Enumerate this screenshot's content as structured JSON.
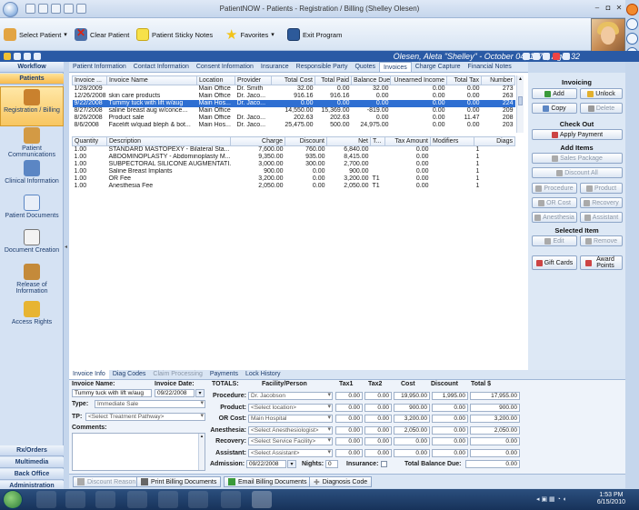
{
  "window": {
    "title": "PatientNOW - Patients - Registration / Billing (Shelley Olesen)",
    "min": "–",
    "max": "◘",
    "close": "✕"
  },
  "toolbar": {
    "select_patient": "Select Patient",
    "clear_patient": "Clear Patient",
    "sticky_notes": "Patient Sticky Notes",
    "favorites": "Favorites",
    "exit_program": "Exit Program"
  },
  "patient_bar": {
    "name": "Olesen, Aleta \"Shelley\" - October 04, 1977, Age: 32"
  },
  "nav": {
    "workflow": "Workflow",
    "patients": "Patients",
    "items": [
      {
        "label": "Registration / Billing",
        "icon": "person-icon"
      },
      {
        "label": "Patient Communications",
        "icon": "megaphone-icon"
      },
      {
        "label": "Clinical Information",
        "icon": "stethoscope-icon"
      },
      {
        "label": "Patient Documents",
        "icon": "documents-icon"
      },
      {
        "label": "Document Creation",
        "icon": "pen-icon"
      },
      {
        "label": "Release of Information",
        "icon": "release-icon"
      },
      {
        "label": "Access Rights",
        "icon": "lock-icon"
      }
    ],
    "rx_orders": "Rx/Orders",
    "multimedia": "Multimedia",
    "back_office": "Back Office",
    "administration": "Administration"
  },
  "tabs": [
    "Patient Information",
    "Contact Information",
    "Consent Information",
    "Insurance",
    "Responsible Party",
    "Quotes",
    "Invoices",
    "Charge Capture",
    "Financial Notes"
  ],
  "active_tab": "Invoices",
  "invoices": {
    "headers": [
      "Invoice ...",
      "Invoice Name",
      "Location",
      "Provider",
      "Total Cost",
      "Total Paid",
      "Balance Due",
      "Unearned Income",
      "Total Tax",
      "Number"
    ],
    "rows": [
      [
        "1/28/2009",
        "",
        "Main Office",
        "Dr. Smith",
        "32.00",
        "0.00",
        "32.00",
        "0.00",
        "0.00",
        "273"
      ],
      [
        "12/26/2008",
        "skin care products",
        "Main Office",
        "Dr. Jaco...",
        "916.16",
        "916.16",
        "0.00",
        "0.00",
        "0.00",
        "263"
      ],
      [
        "9/22/2008",
        "Tummy tuck with lift w/aug",
        "Main Hos...",
        "Dr. Jaco...",
        "0.00",
        "0.00",
        "0.00",
        "0.00",
        "0.00",
        "224"
      ],
      [
        "8/27/2008",
        "saline breast aug w/conce...",
        "Main Office",
        "",
        "14,550.00",
        "15,369.00",
        "-819.00",
        "0.00",
        "0.00",
        "209"
      ],
      [
        "8/26/2008",
        "Product sale",
        "Main Office",
        "Dr. Jaco...",
        "202.63",
        "202.63",
        "0.00",
        "0.00",
        "11.47",
        "208"
      ],
      [
        "8/6/2008",
        "Facelift w/quad bleph & bot...",
        "Main Hos...",
        "Dr. Jaco...",
        "25,475.00",
        "500.00",
        "24,975.00",
        "0.00",
        "0.00",
        "203"
      ]
    ],
    "selected_index": 2
  },
  "items": {
    "headers": [
      "Quantity",
      "Description",
      "Charge",
      "Discount",
      "Net",
      "T...",
      "Tax Amount",
      "Modifiers",
      "Diags"
    ],
    "rows": [
      [
        "1.00",
        "STANDARD MASTOPEXY - Bilateral Sta...",
        "7,600.00",
        "760.00",
        "6,840.00",
        "",
        "0.00",
        "",
        "1"
      ],
      [
        "1.00",
        "ABDOMINOPLASTY - Abdominoplasty M...",
        "9,350.00",
        "935.00",
        "8,415.00",
        "",
        "0.00",
        "",
        "1"
      ],
      [
        "1.00",
        "SUBPECTORAL SILICONE AUGMENTATI...",
        "3,000.00",
        "300.00",
        "2,700.00",
        "",
        "0.00",
        "",
        "1"
      ],
      [
        "1.00",
        "Saline Breast Implants",
        "900.00",
        "0.00",
        "900.00",
        "",
        "0.00",
        "",
        "1"
      ],
      [
        "1.00",
        "OR Fee",
        "3,200.00",
        "0.00",
        "3,200.00",
        "T1",
        "0.00",
        "",
        "1"
      ],
      [
        "1.00",
        "Anesthesia Fee",
        "2,050.00",
        "0.00",
        "2,050.00",
        "T1",
        "0.00",
        "",
        "1"
      ]
    ]
  },
  "right_panel": {
    "invoicing": "Invoicing",
    "add": "Add",
    "unlock": "Unlock",
    "copy": "Copy",
    "delete": "Delete",
    "checkout": "Check Out",
    "apply_payment": "Apply Payment",
    "add_items": "Add Items",
    "sales_package": "Sales Package",
    "discount_all": "Discount All",
    "procedure": "Procedure",
    "product": "Product",
    "or_cost": "OR Cost",
    "recovery": "Recovery",
    "anesthesia": "Anesthesia",
    "assistant": "Assistant",
    "selected_item": "Selected Item",
    "edit": "Edit",
    "remove": "Remove",
    "gift_cards": "Gift Cards",
    "award_points": "Award Points"
  },
  "bottom_tabs": [
    "Invoice Info",
    "Diag Codes",
    "Claim Processing",
    "Payments",
    "Lock History"
  ],
  "invoice_info": {
    "invoice_name_label": "Invoice Name:",
    "invoice_name": "Tummy tuck with lift w/aug",
    "invoice_date_label": "Invoice Date:",
    "invoice_date": "09/22/2008",
    "type_label": "Type:",
    "type": "Immediate Sale",
    "tp_label": "TP:",
    "tp": "<Select Treatment Pathway>",
    "comments_label": "Comments:",
    "totals_label": "TOTALS:",
    "col_headers": [
      "Facility/Person",
      "Tax1",
      "Tax2",
      "Cost",
      "Discount",
      "Total $"
    ],
    "rows": [
      {
        "label": "Procedure:",
        "person": "Dr. Jacobson",
        "tax1": "0.00",
        "tax2": "0.00",
        "cost": "19,950.00",
        "discount": "1,995.00",
        "total": "17,955.00"
      },
      {
        "label": "Product:",
        "person": "<Select location>",
        "tax1": "0.00",
        "tax2": "0.00",
        "cost": "900.00",
        "discount": "0.00",
        "total": "900.00"
      },
      {
        "label": "OR Cost:",
        "person": "Main Hospital",
        "tax1": "0.00",
        "tax2": "0.00",
        "cost": "3,200.00",
        "discount": "0.00",
        "total": "3,200.00"
      },
      {
        "label": "Anesthesia:",
        "person": "<Select Anesthesiologist>",
        "tax1": "0.00",
        "tax2": "0.00",
        "cost": "2,050.00",
        "discount": "0.00",
        "total": "2,050.00"
      },
      {
        "label": "Recovery:",
        "person": "<Select Service Facility>",
        "tax1": "0.00",
        "tax2": "0.00",
        "cost": "0.00",
        "discount": "0.00",
        "total": "0.00"
      },
      {
        "label": "Assistant:",
        "person": "<Select Assistant>",
        "tax1": "0.00",
        "tax2": "0.00",
        "cost": "0.00",
        "discount": "0.00",
        "total": "0.00"
      }
    ],
    "admission_label": "Admission:",
    "admission": "09/22/2008",
    "nights_label": "Nights:",
    "nights": "0",
    "insurance_label": "Insurance:",
    "total_balance_label": "Total Balance Due:",
    "total_balance": "0.00"
  },
  "bottom_buttons": {
    "discount_reason": "Discount Reason",
    "print_billing": "Print Billing Documents",
    "email_billing": "Email Billing Documents",
    "diagnosis_code": "Diagnosis Code"
  },
  "taskbar": {
    "time": "1:53 PM",
    "date": "6/15/2010"
  },
  "colors": {
    "accent": "#2a5aa5",
    "selection": "#2e6fd2",
    "nav_active": "#f8c661"
  }
}
